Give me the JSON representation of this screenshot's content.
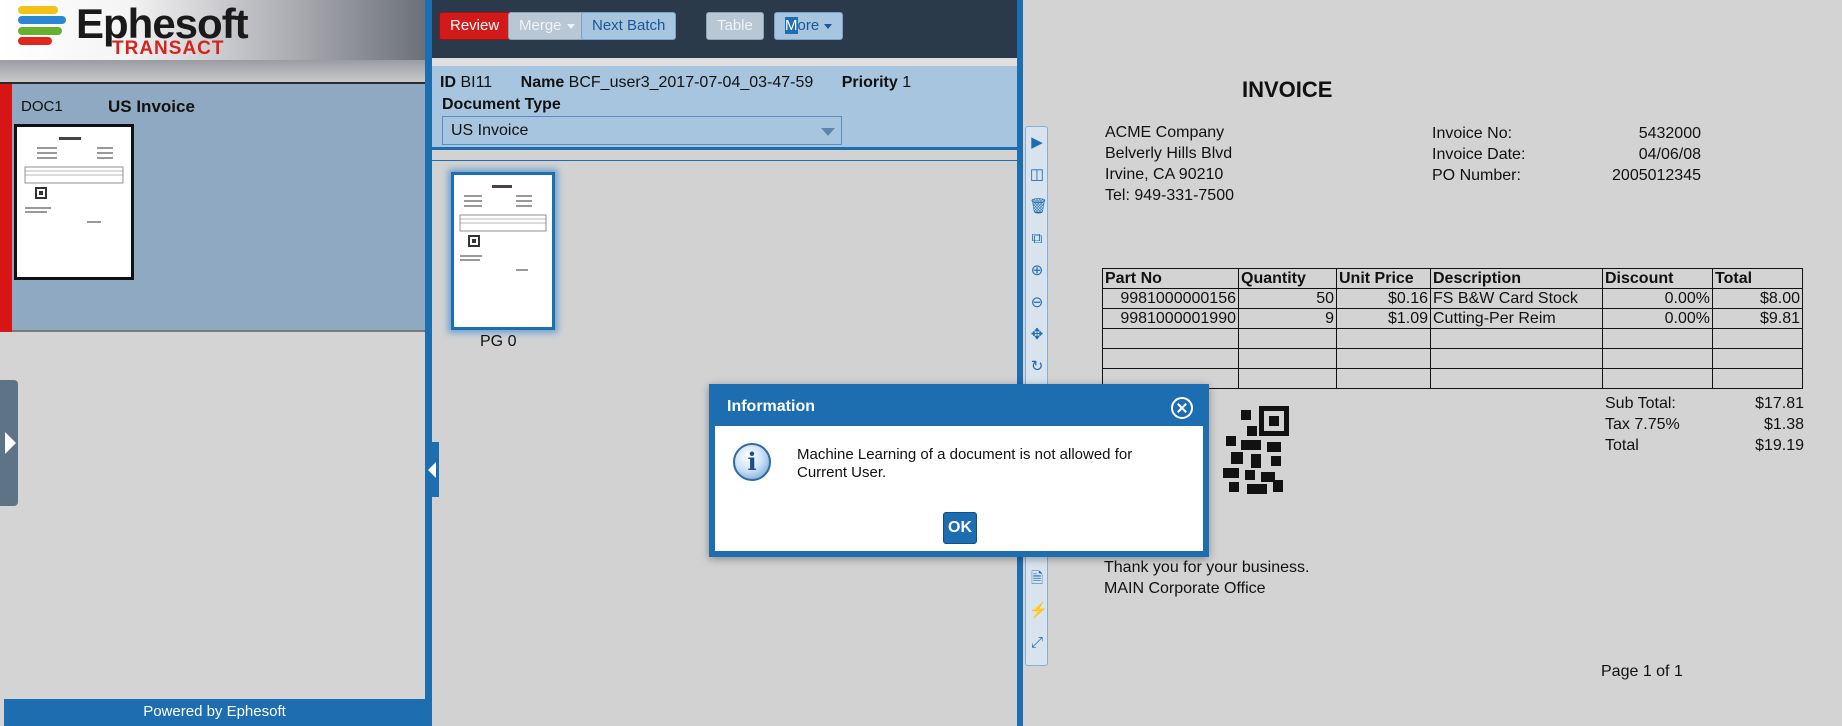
{
  "logo": {
    "name": "Ephesoft",
    "sub": "TRANSACT"
  },
  "document": {
    "id": "DOC1",
    "type": "US Invoice"
  },
  "footer": "Powered by Ephesoft",
  "toolbar": {
    "review": "Review",
    "merge": "Merge",
    "next_batch": "Next Batch",
    "table": "Table",
    "more_m": "M",
    "more_rest": "ore"
  },
  "batch": {
    "id_label": "ID",
    "id": "BI11",
    "name_label": "Name",
    "name": "BCF_user3_2017-07-04_03-47-59",
    "priority_label": "Priority",
    "priority": "1",
    "doc_type_label": "Document Type",
    "doc_type": "US Invoice",
    "page_label": "PG 0"
  },
  "invoice": {
    "title": "INVOICE",
    "company": [
      "ACME Company",
      "Belverly Hills Blvd",
      "Irvine, CA 90210",
      "Tel: 949-331-7500"
    ],
    "meta": [
      {
        "label": "Invoice No:",
        "value": "5432000"
      },
      {
        "label": "Invoice Date:",
        "value": "04/06/08"
      },
      {
        "label": "PO Number:",
        "value": "2005012345"
      }
    ],
    "headers": [
      "Part No",
      "Quantity",
      "Unit Price",
      "Description",
      "Discount",
      "Total"
    ],
    "rows": [
      [
        "9981000000156",
        "50",
        "$0.16",
        "FS B&W Card Stock",
        "0.00%",
        "$8.00"
      ],
      [
        "9981000001990",
        "9",
        "$1.09",
        "Cutting-Per Reim",
        "0.00%",
        "$9.81"
      ]
    ],
    "totals": [
      {
        "label": "Sub Total:",
        "value": "$17.81"
      },
      {
        "label": "Tax 7.75%",
        "value": "$1.38"
      },
      {
        "label": "Total",
        "value": "$19.19"
      }
    ],
    "thanks": "Thank you for your business.",
    "office": "MAIN Corporate Office",
    "page": "Page 1 of 1"
  },
  "modal": {
    "title": "Information",
    "message": "Machine Learning of a document is not allowed for Current User.",
    "ok": "OK"
  }
}
